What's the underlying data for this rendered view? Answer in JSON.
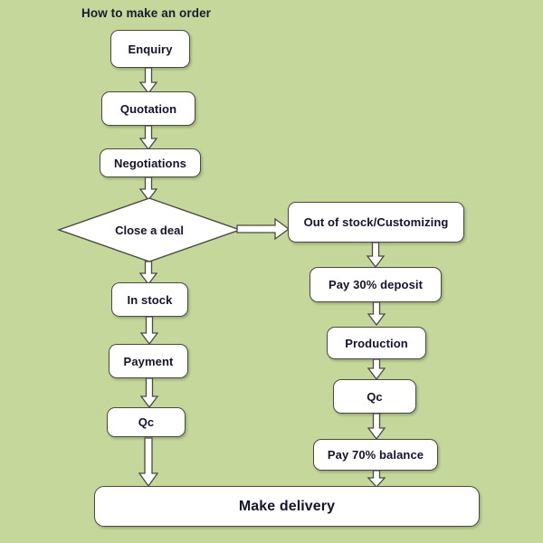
{
  "diagram": {
    "title": "How to make  an order",
    "background_color": "#c5d79a",
    "node_fill": "#ffffff",
    "node_border": "#4a4a42",
    "text_color": "#14142b",
    "type": "flowchart"
  },
  "nodes": {
    "enquiry": "Enquiry",
    "quotation": "Quotation",
    "negotiations": "Negotiations",
    "close_a_deal": "Close a deal",
    "out_of_stock": "Out of stock/Customizing",
    "in_stock": "In stock",
    "pay_30_deposit": "Pay 30%  deposit",
    "payment": "Payment",
    "production": "Production",
    "qc_left": "Qc",
    "qc_right": "Qc",
    "pay_70_balance": "Pay 70%  balance",
    "make_delivery": "Make delivery"
  },
  "edges": [
    {
      "from": "enquiry",
      "to": "quotation",
      "direction": "down"
    },
    {
      "from": "quotation",
      "to": "negotiations",
      "direction": "down"
    },
    {
      "from": "negotiations",
      "to": "close_a_deal",
      "direction": "down"
    },
    {
      "from": "close_a_deal",
      "to": "out_of_stock",
      "direction": "right"
    },
    {
      "from": "close_a_deal",
      "to": "in_stock",
      "direction": "down"
    },
    {
      "from": "in_stock",
      "to": "payment",
      "direction": "down"
    },
    {
      "from": "payment",
      "to": "qc_left",
      "direction": "down"
    },
    {
      "from": "qc_left",
      "to": "make_delivery",
      "direction": "down"
    },
    {
      "from": "out_of_stock",
      "to": "pay_30_deposit",
      "direction": "down"
    },
    {
      "from": "pay_30_deposit",
      "to": "production",
      "direction": "down"
    },
    {
      "from": "production",
      "to": "qc_right",
      "direction": "down"
    },
    {
      "from": "qc_right",
      "to": "pay_70_balance",
      "direction": "down"
    },
    {
      "from": "pay_70_balance",
      "to": "make_delivery",
      "direction": "down"
    }
  ]
}
